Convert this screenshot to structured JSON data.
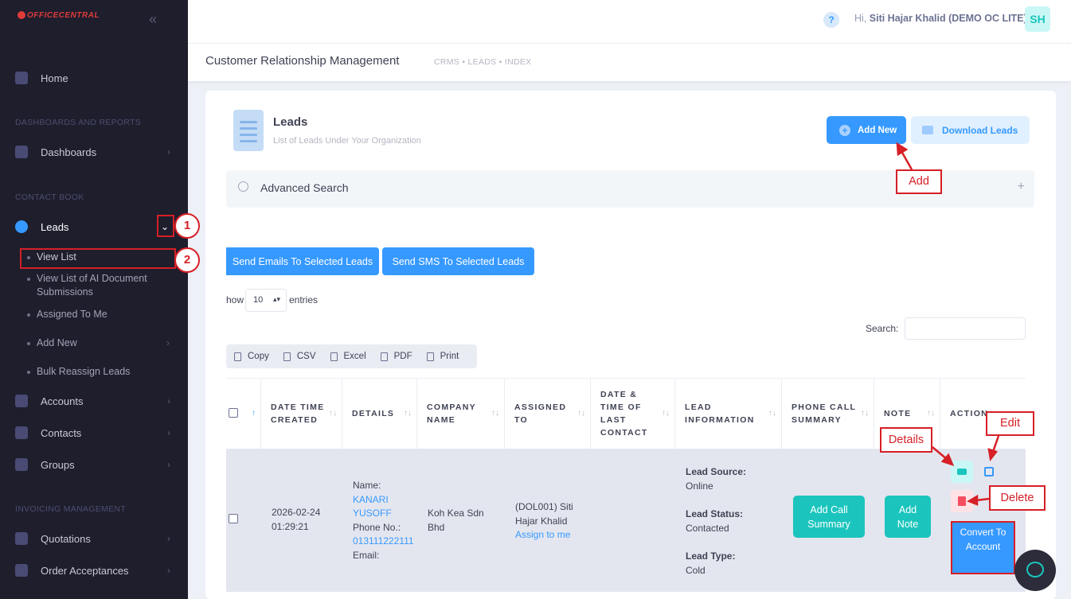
{
  "brand": {
    "name": "OFFICECENTRAL"
  },
  "sidebar": {
    "home": "Home",
    "section_dashboards": "DASHBOARDS AND REPORTS",
    "dashboards": "Dashboards",
    "section_contact": "CONTACT BOOK",
    "leads": "Leads",
    "leads_sub": [
      "View List",
      "View List of AI Document Submissions",
      "Assigned To Me",
      "Add New",
      "Bulk Reassign Leads"
    ],
    "accounts": "Accounts",
    "contacts": "Contacts",
    "groups": "Groups",
    "section_invoicing": "INVOICING MANAGEMENT",
    "quotations": "Quotations",
    "order_acceptances": "Order Acceptances"
  },
  "topbar": {
    "help": "?",
    "greeting_prefix": "Hi,",
    "user": "Siti Hajar Khalid (DEMO OC LITE)",
    "avatar": "SH"
  },
  "subheader": {
    "title": "Customer Relationship Management",
    "breadcrumb": "CRMS  •  LEADS  •  INDEX"
  },
  "card": {
    "title": "Leads",
    "subtitle": "List of Leads Under Your Organization",
    "add_new": "Add New",
    "download": "Download Leads",
    "advanced_search": "Advanced Search",
    "plus": "+",
    "send_emails": "Send Emails To Selected Leads",
    "send_sms": "Send SMS To Selected Leads",
    "show_label": "how",
    "show_value": "10",
    "entries_label": "entries",
    "search_label": "Search:",
    "export": [
      "Copy",
      "CSV",
      "Excel",
      "PDF",
      "Print"
    ]
  },
  "table": {
    "headers": [
      "DATE TIME CREATED",
      "DETAILS",
      "COMPANY NAME",
      "ASSIGNED TO",
      "DATE & TIME OF LAST CONTACT",
      "LEAD INFORMATION",
      "PHONE CALL SUMMARY",
      "NOTE",
      "ACTION"
    ],
    "row": {
      "date": "2026-02-24",
      "time": "01:29:21",
      "name_label": "Name:",
      "name_1": "KANARI",
      "name_2": "YUSOFF",
      "phone_label": "Phone No.:",
      "phone": "013111222111",
      "email_label": "Email:",
      "company_1": "Koh Kea Sdn",
      "company_2": "Bhd",
      "assigned_1": "(DOL001) Siti",
      "assigned_2": "Hajar Khalid",
      "assign_me": "Assign to me",
      "source_label": "Lead Source:",
      "source": "Online",
      "status_label": "Lead Status:",
      "status": "Contacted",
      "type_label": "Lead Type:",
      "type": "Cold",
      "add_call": "Add Call Summary",
      "add_note": "Add Note",
      "convert": "Convert To Account"
    }
  },
  "annotations": {
    "one": "1",
    "two": "2",
    "add": "Add",
    "details": "Details",
    "edit": "Edit",
    "delete": "Delete"
  },
  "colors": {
    "primary": "#3699ff",
    "teal": "#1bc5bd",
    "danger": "#d61f26",
    "sidebar": "#1e1e2d"
  }
}
